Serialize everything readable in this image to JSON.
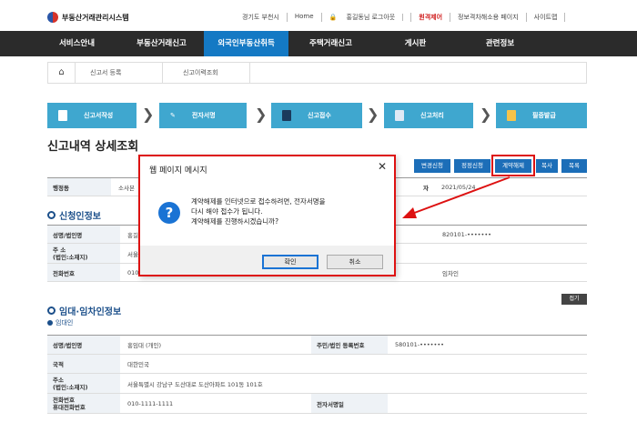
{
  "header": {
    "logo_text": "부동산거래관리시스템",
    "utils": [
      "경기도 부천시",
      "Home",
      "홍길동님 로그아웃",
      "원격제어",
      "정보격차해소용 페이지",
      "사이트맵"
    ]
  },
  "nav": [
    "서비스안내",
    "부동산거래신고",
    "외국인부동산취득",
    "주택거래신고",
    "게시판",
    "관련정보"
  ],
  "breadcrumb": [
    "신고서 등록",
    "신고이력조회"
  ],
  "steps": [
    "신고서작성",
    "전자서명",
    "신고접수",
    "신고처리",
    "필증발급"
  ],
  "page_title": "신고내역 상세조회",
  "actions": [
    "변경신청",
    "정정신청",
    "계약해제",
    "복사",
    "목록"
  ],
  "status_row": {
    "label": "행정동",
    "value": "소사본",
    "date_label": "자",
    "date": "2021/05/24"
  },
  "applicant": {
    "title": "신청인정보",
    "name_label": "성명/법인명",
    "name_value": "홍길",
    "addr_label": "주    소\n(법인:소재지)",
    "addr_value": "서울",
    "phone_label": "전화번호",
    "phone_value": "010",
    "id_value": "820101-•••••••",
    "sign_value": "임차인"
  },
  "lease": {
    "title": "임대·임차인정보",
    "collapse": "접기",
    "sub": "임대인",
    "rows": {
      "name_label": "성명/법인명",
      "name_value": "홍임대 (개인)",
      "id_label": "주민/법인 등록번호",
      "id_value": "580101-•••••••",
      "nation_label": "국적",
      "nation_value": "대한민국",
      "addr_label": "주소\n(법인:소재지)",
      "addr_value": "서울특별시 강남구 도산대로 도산아파트 101동 101호",
      "phone_label": "전화번호\n휴대전화번호",
      "phone_value": "010-1111-1111",
      "sign_label": "전자서명일",
      "sign_value": ""
    }
  },
  "dialog": {
    "title": "웹 페이지 메시지",
    "close": "✕",
    "icon": "?",
    "lines": [
      "계약해제를 인터넷으로 접수하려면, 전자서명을",
      "다시 해야 접수가 됩니다.",
      "계약해제를 진행하시겠습니까?"
    ],
    "ok": "확인",
    "cancel": "취소"
  },
  "colors": {
    "nav_bg": "#2b2b2b",
    "nav_active": "#1479c4",
    "step_bg": "#3fa7cf",
    "highlight": "#dd1111"
  }
}
